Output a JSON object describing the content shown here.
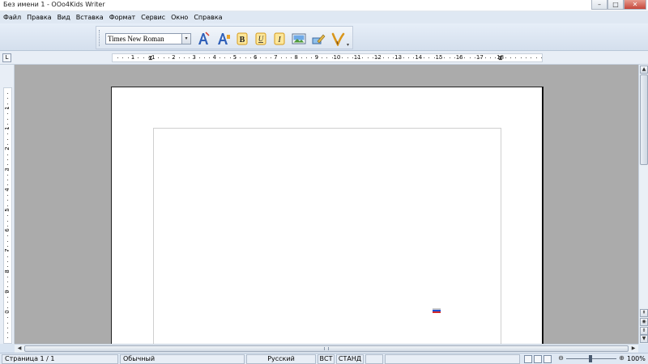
{
  "window": {
    "title": "Без имени 1 - OOo4Kids Writer",
    "minimize": "–",
    "maximize": "□",
    "close": "✕"
  },
  "menu": [
    "Файл",
    "Правка",
    "Вид",
    "Вставка",
    "Формат",
    "Сервис",
    "Окно",
    "Справка"
  ],
  "toolbar": {
    "font_name": "Times New Roman",
    "dropdown_arrow": "▾",
    "more_arrow": "▾",
    "buttons": [
      {
        "name": "fontwork-icon"
      },
      {
        "name": "fontwork-gallery-icon"
      },
      {
        "name": "bold-icon",
        "glyph": "B"
      },
      {
        "name": "underline-icon",
        "glyph": "U"
      },
      {
        "name": "italic-icon",
        "glyph": "I"
      },
      {
        "name": "insert-image-icon"
      },
      {
        "name": "draw-icon"
      },
      {
        "name": "brush-icon"
      }
    ]
  },
  "ruler": {
    "tab_selector": "L",
    "h_numbers": [
      "1",
      "1",
      "2",
      "3",
      "4",
      "5",
      "6",
      "7",
      "8",
      "9",
      "10",
      "11",
      "12",
      "13",
      "14",
      "15",
      "16",
      "17",
      "18"
    ],
    "v_numbers": [
      "1",
      "1",
      "2",
      "3",
      "4",
      "5",
      "6",
      "7",
      "8",
      "9",
      "0"
    ]
  },
  "scroll": {
    "up": "▲",
    "down": "▼",
    "left": "◀",
    "right": "▶",
    "prev": "⇞",
    "next": "⇟",
    "nav": "◉"
  },
  "status": {
    "page": "Страница  1 / 1",
    "style": "Обычный",
    "language": "Русский",
    "insert_mode": "ВСТ",
    "selection_mode": "СТАНД",
    "zoom": "100%",
    "zoom_minus": "⊖",
    "zoom_plus": "⊕"
  },
  "colors": {
    "flag_white": "#ffffff",
    "flag_blue": "#1f4fd1",
    "flag_red": "#d42b2b"
  }
}
